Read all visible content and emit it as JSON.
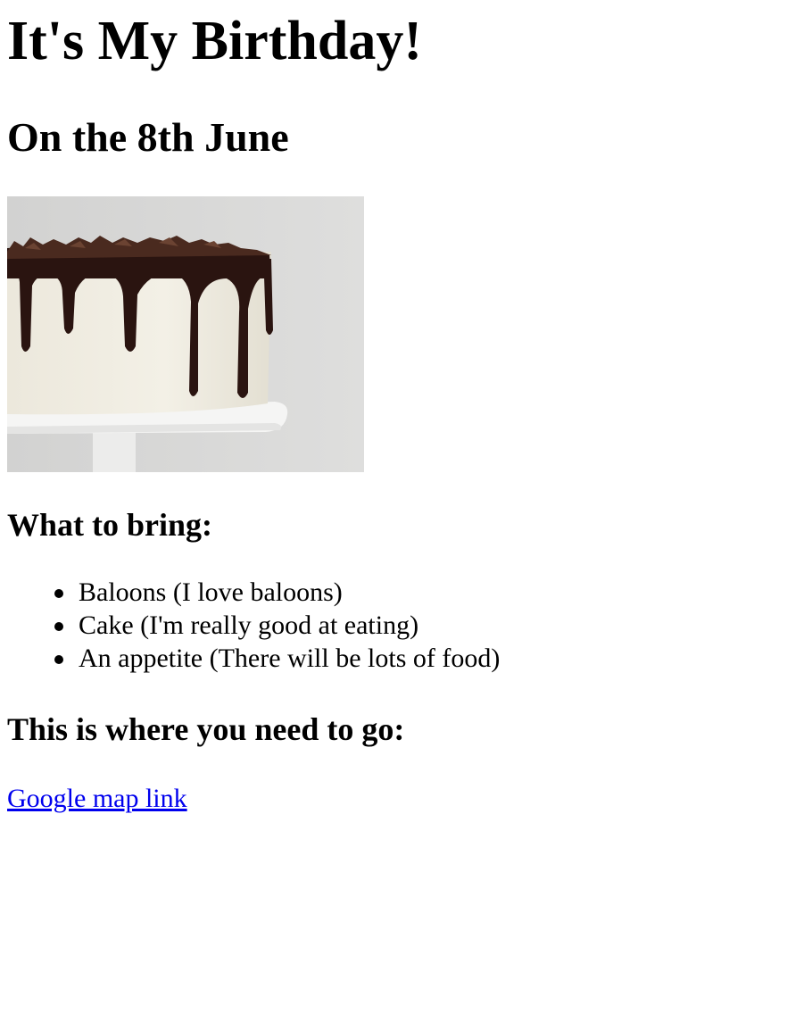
{
  "page": {
    "title": "It's My Birthday!",
    "subtitle": "On the 8th June"
  },
  "image": {
    "alt_icon": "cake-image",
    "colors": {
      "background": "#d9d9d8",
      "frosting": "#f1eee3",
      "chocolate": "#2a1410",
      "stand": "#f4f4f3"
    }
  },
  "bring": {
    "heading": "What to bring:",
    "items": [
      "Baloons (I love baloons)",
      "Cake (I'm really good at eating)",
      "An appetite (There will be lots of food)"
    ]
  },
  "location": {
    "heading": "This is where you need to go:",
    "link_label": "Google map link",
    "link_color": "#0000ee"
  }
}
